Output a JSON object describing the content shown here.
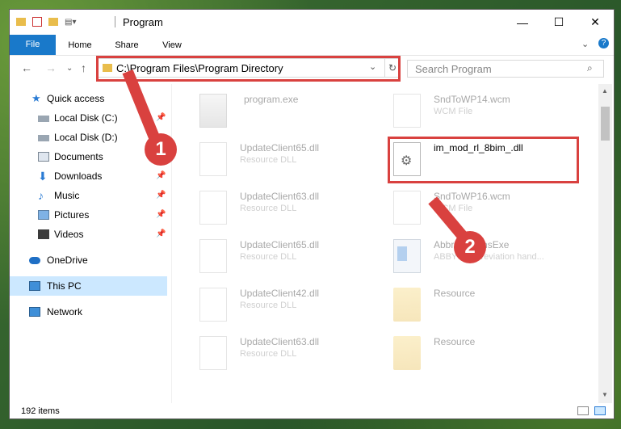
{
  "window": {
    "title": "Program"
  },
  "ribbon": {
    "tabs": [
      "File",
      "Home",
      "Share",
      "View"
    ]
  },
  "address": {
    "path": "C:\\Program Files\\Program Directory"
  },
  "search": {
    "placeholder": "Search Program"
  },
  "sidebar": {
    "items": [
      {
        "label": "Quick access"
      },
      {
        "label": "Local Disk (C:)"
      },
      {
        "label": "Local Disk (D:)"
      },
      {
        "label": "Documents"
      },
      {
        "label": "Downloads"
      },
      {
        "label": "Music"
      },
      {
        "label": "Pictures"
      },
      {
        "label": "Videos"
      },
      {
        "label": "OneDrive"
      },
      {
        "label": "This PC"
      },
      {
        "label": "Network"
      }
    ]
  },
  "files": [
    {
      "name": "program.exe",
      "type": ""
    },
    {
      "name": "SndToWP14.wcm",
      "type": "WCM File"
    },
    {
      "name": "UpdateClient65.dll",
      "type": "Resource DLL"
    },
    {
      "name": "im_mod_rl_8bim_.dll",
      "type": ""
    },
    {
      "name": "UpdateClient63.dll",
      "type": "Resource DLL"
    },
    {
      "name": "SndToWP16.wcm",
      "type": "WCM File"
    },
    {
      "name": "UpdateClient65.dll",
      "type": "Resource DLL"
    },
    {
      "name": "AbbreviationsExe",
      "type": "ABBYY Abbreviation hand..."
    },
    {
      "name": "UpdateClient42.dll",
      "type": "Resource DLL"
    },
    {
      "name": "Resource",
      "type": ""
    },
    {
      "name": "UpdateClient63.dll",
      "type": "Resource DLL"
    },
    {
      "name": "Resource",
      "type": ""
    }
  ],
  "status": {
    "count": "192 items"
  },
  "annotations": {
    "one": "1",
    "two": "2"
  }
}
